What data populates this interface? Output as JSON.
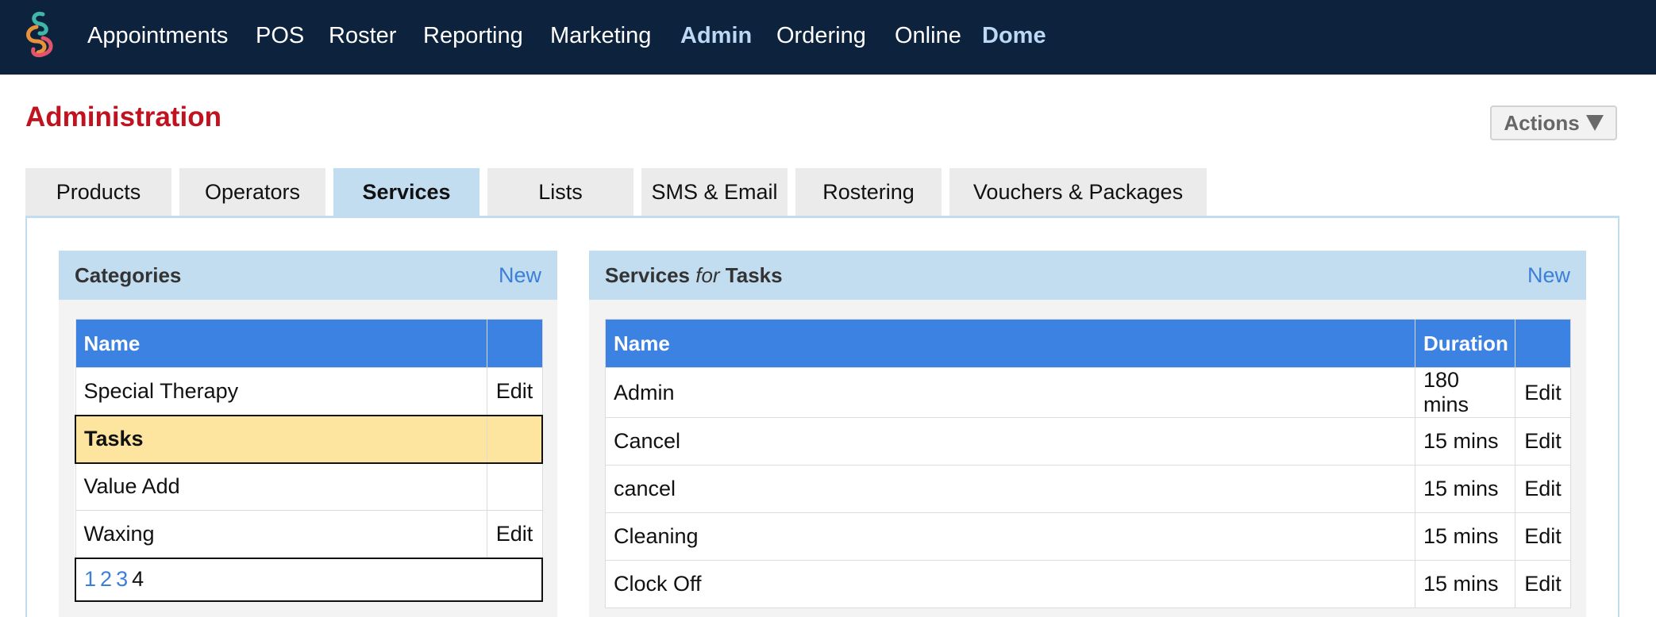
{
  "nav": {
    "items": [
      {
        "label": "Appointments",
        "active": false
      },
      {
        "label": "POS",
        "active": false
      },
      {
        "label": "Roster",
        "active": false
      },
      {
        "label": "Reporting",
        "active": false
      },
      {
        "label": "Marketing",
        "active": false
      },
      {
        "label": "Admin",
        "active": true
      },
      {
        "label": "Ordering",
        "active": false
      },
      {
        "label": "Online",
        "active": false
      },
      {
        "label": "Dome",
        "active": true
      }
    ]
  },
  "page": {
    "title": "Administration",
    "actions_label": "Actions"
  },
  "tabs": [
    {
      "label": "Products"
    },
    {
      "label": "Operators"
    },
    {
      "label": "Services",
      "active": true
    },
    {
      "label": "Lists"
    },
    {
      "label": "SMS & Email"
    },
    {
      "label": "Rostering"
    },
    {
      "label": "Vouchers & Packages"
    }
  ],
  "categories": {
    "title": "Categories",
    "new_label": "New",
    "header": {
      "name": "Name"
    },
    "rows": [
      {
        "name": "Special Therapy",
        "edit": "Edit"
      },
      {
        "name": "Tasks",
        "edit": "",
        "selected": true
      },
      {
        "name": "Value Add",
        "edit": ""
      },
      {
        "name": "Waxing",
        "edit": "Edit"
      }
    ],
    "pages": [
      "1",
      "2",
      "3",
      "4"
    ],
    "current_page": "4"
  },
  "services": {
    "title_prefix": "Services",
    "title_for": "for",
    "title_category": "Tasks",
    "new_label": "New",
    "header": {
      "name": "Name",
      "duration": "Duration"
    },
    "rows": [
      {
        "name": "Admin",
        "duration": "180 mins",
        "edit": "Edit"
      },
      {
        "name": "Cancel",
        "duration": "15 mins",
        "edit": "Edit"
      },
      {
        "name": "cancel",
        "duration": "15 mins",
        "edit": "Edit"
      },
      {
        "name": "Cleaning",
        "duration": "15 mins",
        "edit": "Edit"
      },
      {
        "name": "Clock Off",
        "duration": "15 mins",
        "edit": "Edit"
      }
    ]
  },
  "colors": {
    "nav_bg": "#0d223d",
    "title_red": "#c0131f",
    "accent_blue": "#3b82e2",
    "link_blue": "#3b7fd9",
    "tab_active": "#c2dcf0",
    "selected_row": "#fde5a0"
  }
}
